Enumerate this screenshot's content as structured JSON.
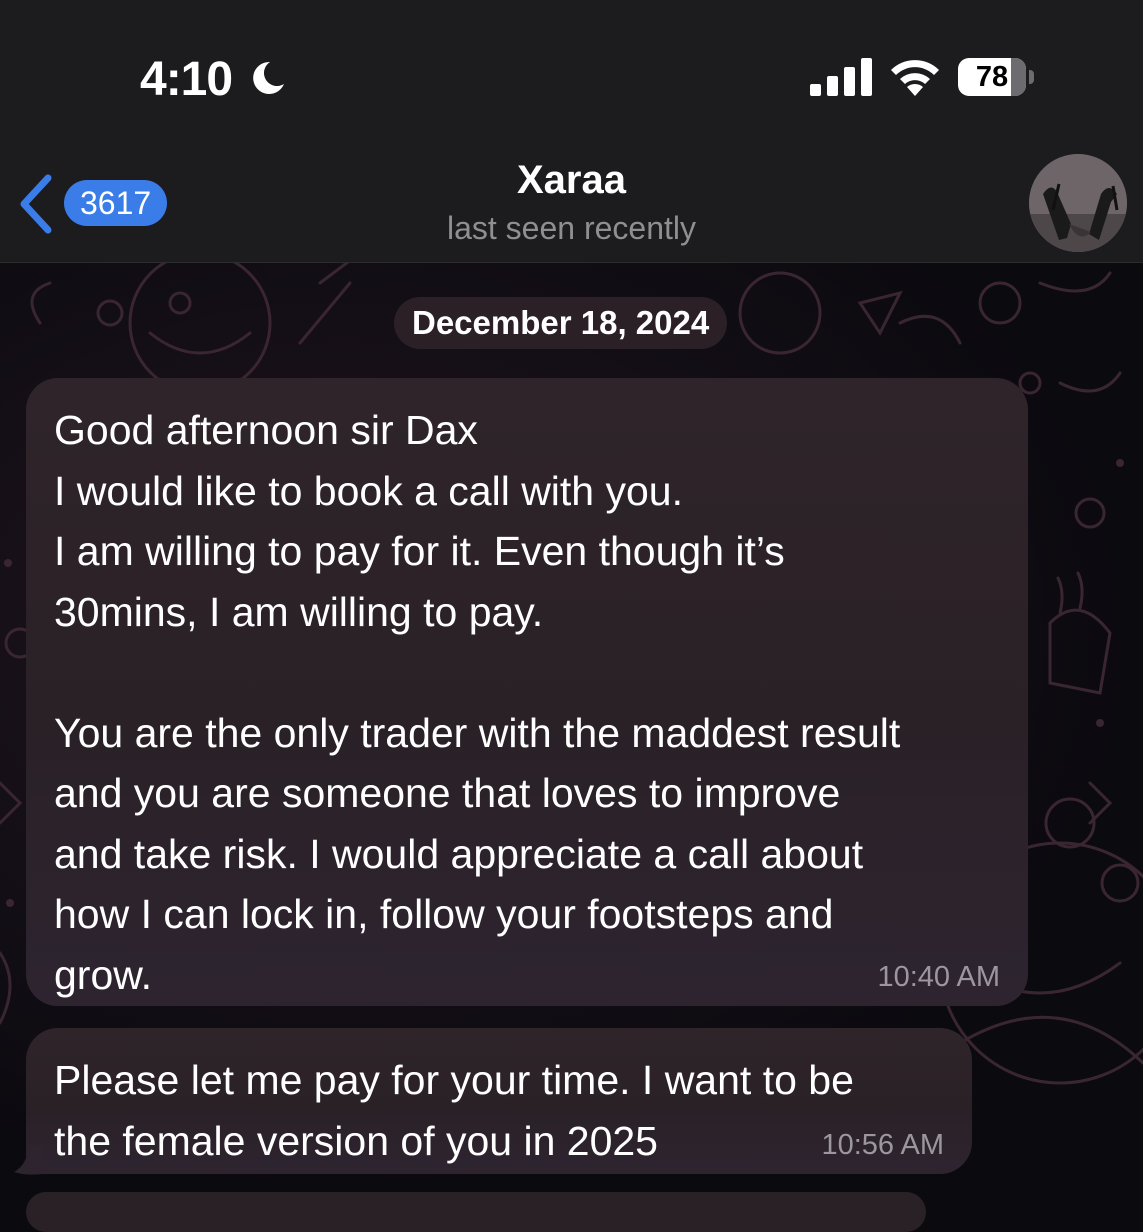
{
  "status_bar": {
    "time": "4:10",
    "battery_level": "78",
    "battery_fraction": 0.78
  },
  "header": {
    "back_badge": "3617",
    "title": "Xaraa",
    "subtitle": "last seen recently"
  },
  "chat": {
    "date_separator": "December 18, 2024",
    "messages": [
      {
        "text": "Good afternoon sir Dax\nI would like to book a call with you.\nI am willing to pay for it. Even though it’s\n30mins, I am willing to pay.\n\nYou are the only trader with the maddest result\nand you are someone that loves to improve\nand take risk. I would appreciate a call about\nhow I can lock in, follow your footsteps and\ngrow.",
        "time": "10:40 AM"
      },
      {
        "text": "Please let me pay for your time. I want to be\nthe female version of you in 2025",
        "time": "10:56 AM"
      }
    ]
  },
  "colors": {
    "accent": "#3a7ce8",
    "header_bg": "#1c1c1e",
    "bubble_bg": "#2e2429",
    "timestamp": "#9c969e"
  },
  "icons": [
    "moon-icon",
    "cellular-signal-icon",
    "wifi-icon",
    "battery-icon",
    "back-chevron-icon"
  ]
}
